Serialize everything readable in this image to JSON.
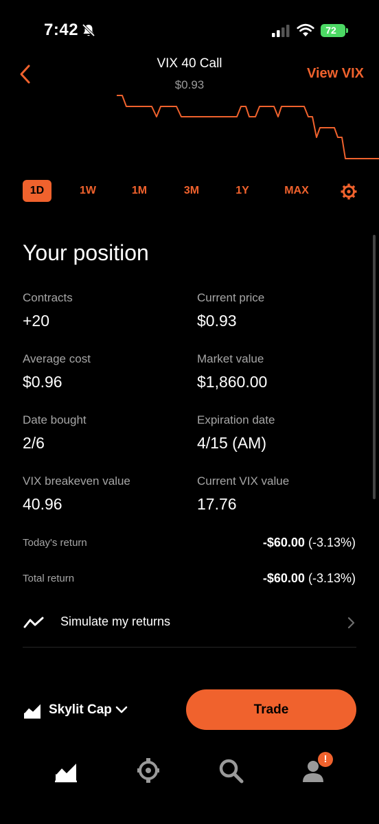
{
  "status_bar": {
    "time": "7:42",
    "battery": "72"
  },
  "header": {
    "title": "VIX 40 Call",
    "price": "$0.93",
    "view_link": "View VIX"
  },
  "tabs": [
    {
      "label": "1D",
      "active": true
    },
    {
      "label": "1W",
      "active": false
    },
    {
      "label": "1M",
      "active": false
    },
    {
      "label": "3M",
      "active": false
    },
    {
      "label": "1Y",
      "active": false
    },
    {
      "label": "MAX",
      "active": false
    }
  ],
  "position": {
    "title": "Your position",
    "stats": [
      {
        "label": "Contracts",
        "value": "+20"
      },
      {
        "label": "Current price",
        "value": "$0.93"
      },
      {
        "label": "Average cost",
        "value": "$0.96"
      },
      {
        "label": "Market value",
        "value": "$1,860.00"
      },
      {
        "label": "Date bought",
        "value": "2/6"
      },
      {
        "label": "Expiration date",
        "value": "4/15 (AM)"
      },
      {
        "label": "VIX breakeven value",
        "value": "40.96"
      },
      {
        "label": "Current VIX value",
        "value": "17.76"
      }
    ],
    "todays_return": {
      "label": "Today's return",
      "amount": "-$60.00",
      "percent": "(-3.13%)"
    },
    "total_return": {
      "label": "Total return",
      "amount": "-$60.00",
      "percent": "(-3.13%)"
    }
  },
  "simulate": {
    "label": "Simulate my returns",
    "icon": "trend-line-icon"
  },
  "account": {
    "name": "Skylit Cap"
  },
  "trade_button": "Trade",
  "notification_badge": "!",
  "nav": [
    "investing-icon",
    "crypto-icon",
    "search-icon",
    "account-icon"
  ],
  "colors": {
    "accent": "#f0622d",
    "background": "#000000",
    "muted_text": "#a6a6a6",
    "battery": "#4cd964"
  }
}
